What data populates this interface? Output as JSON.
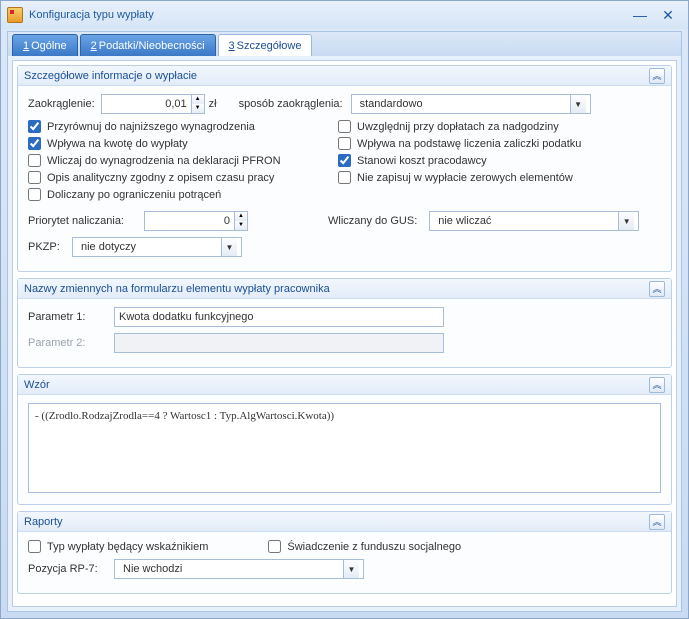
{
  "title": "Konfiguracja typu wypłaty",
  "tabs": [
    {
      "acc": "1",
      "label": "Ogólne"
    },
    {
      "acc": "2",
      "label": "Podatki/Nieobecności"
    },
    {
      "acc": "3",
      "label": "Szczegółowe"
    }
  ],
  "grp_detail": {
    "title": "Szczegółowe informacje o wypłacie",
    "round_label": "Zaokrąglenie:",
    "round_value": "0,01",
    "round_unit": "zł",
    "round_mode_label": "sposób zaokrąglenia:",
    "round_mode_value": "standardowo",
    "checks": {
      "c0": "Przyrównuj do najniższego wynagrodzenia",
      "c1": "Uwzględnij przy dopłatach za nadgodziny",
      "c2": "Wpływa na kwotę do wypłaty",
      "c3": "Wpływa na podstawę liczenia zaliczki podatku",
      "c4": "Wliczaj do wynagrodzenia na deklaracji PFRON",
      "c5": "Stanowi koszt pracodawcy",
      "c6": "Opis analityczny zgodny z opisem czasu pracy",
      "c7": "Nie zapisuj w wypłacie zerowych elementów",
      "c8": "Doliczany po ograniczeniu potrąceń"
    },
    "priority_label": "Priorytet naliczania:",
    "priority_value": "0",
    "gus_label": "Wliczany do GUS:",
    "gus_value": "nie wliczać",
    "pkzp_label": "PKZP:",
    "pkzp_value": "nie dotyczy"
  },
  "grp_vars": {
    "title": "Nazwy zmiennych na formularzu elementu wypłaty pracownika",
    "p1_label": "Parametr 1:",
    "p1_value": "Kwota dodatku funkcyjnego",
    "p2_label": "Parametr 2:",
    "p2_value": ""
  },
  "grp_expr": {
    "title": "Wzór",
    "text": "- ((Zrodlo.RodzajZrodla==4 ? Wartosc1 : Typ.AlgWartosci.Kwota))"
  },
  "grp_reports": {
    "title": "Raporty",
    "chk_indicator": "Typ wypłaty będący wskaźnikiem",
    "chk_social": "Świadczenie z funduszu socjalnego",
    "rp7_label": "Pozycja RP-7:",
    "rp7_value": "Nie wchodzi"
  }
}
